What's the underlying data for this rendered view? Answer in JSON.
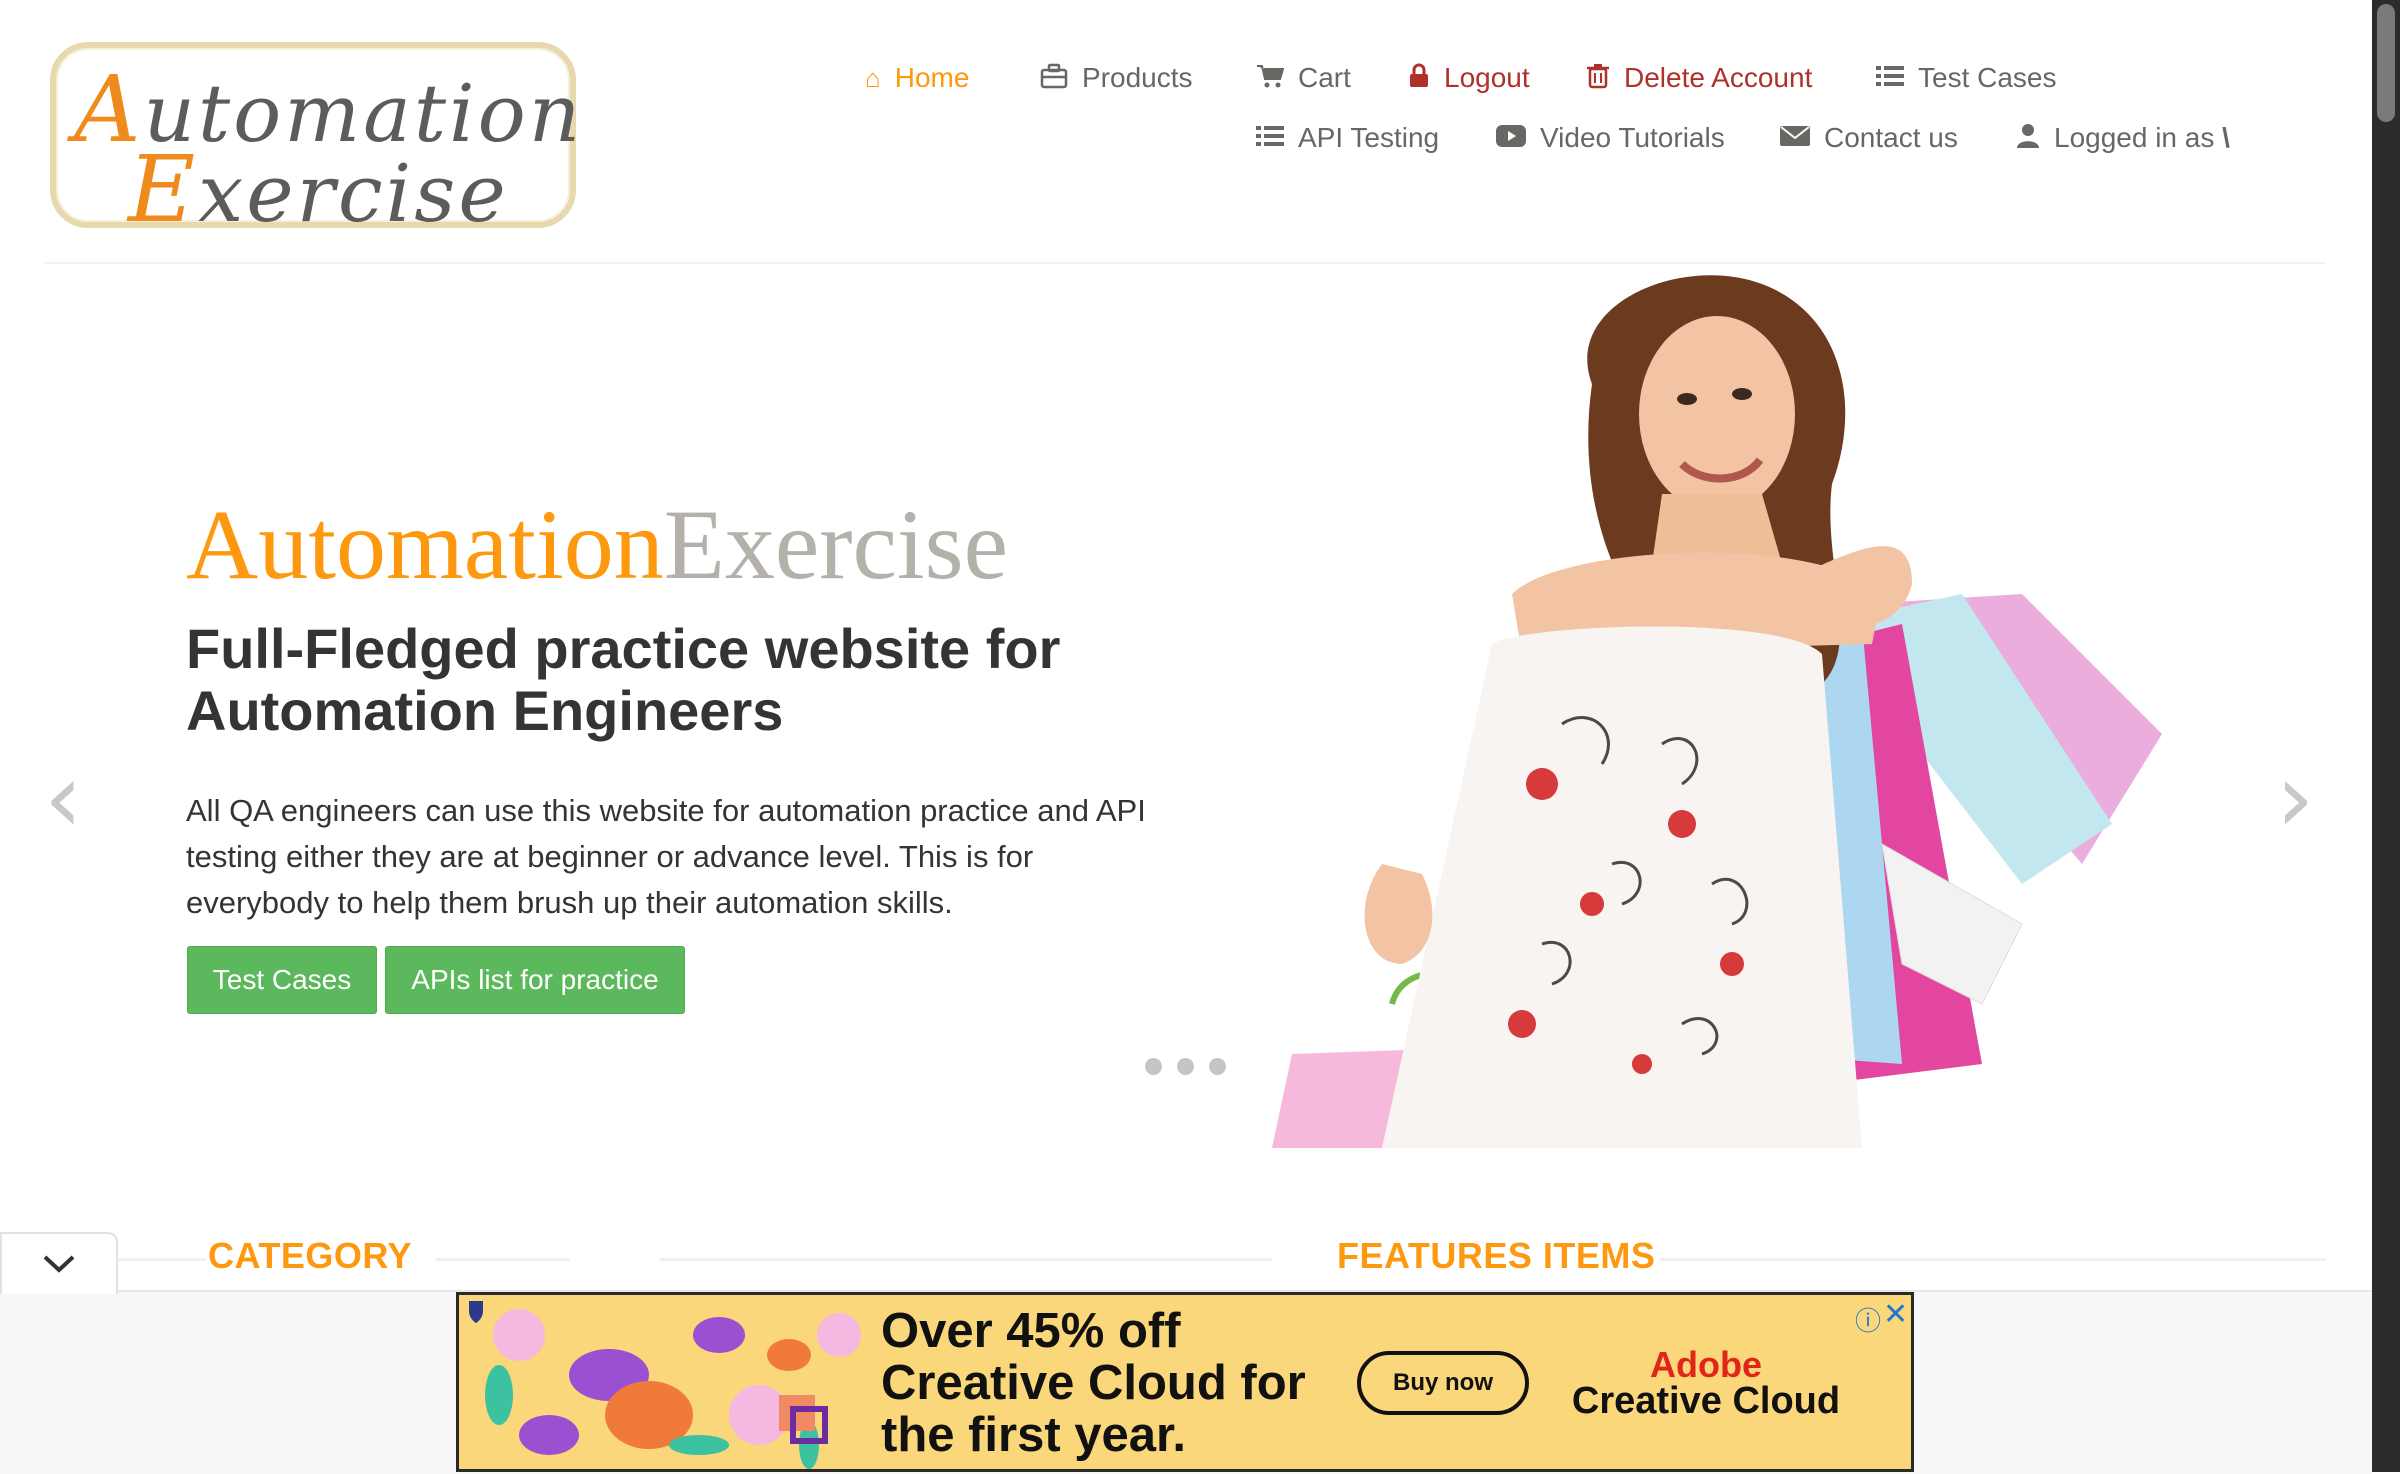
{
  "logo": {
    "line1_cap": "A",
    "line1_rest": "utomation",
    "line2_cap": "E",
    "line2_rest": "xercise"
  },
  "nav": {
    "home": "Home",
    "products": "Products",
    "cart": "Cart",
    "logout": "Logout",
    "delete_account": "Delete Account",
    "test_cases": "Test Cases",
    "api_testing": "API Testing",
    "video_tutorials": "Video Tutorials",
    "contact_us": "Contact us",
    "logged_in_as": "Logged in as",
    "logged_in_user": "\\"
  },
  "hero": {
    "brand_part1": "Automation",
    "brand_part2": "Exercise",
    "heading": "Full-Fledged practice website for Automation Engineers",
    "description": "All QA engineers can use this website for automation practice and API testing either they are at beginner or advance level. This is for everybody to help them brush up their automation skills.",
    "btn_test_cases": "Test Cases",
    "btn_apis": "APIs list for practice",
    "prev_arrow": "‹",
    "next_arrow": "›"
  },
  "sections": {
    "category": "CATEGORY",
    "features": "FEATURES ITEMS"
  },
  "ad": {
    "headline": "Over 45% off Creative Cloud for the first year.",
    "button": "Buy now",
    "brand_line1": "Adobe",
    "brand_line2": "Creative Cloud",
    "info_icon": "ⓘ",
    "close_icon": "✕"
  },
  "colors": {
    "accent": "#fe980f",
    "green": "#5cb85c",
    "text": "#696763",
    "danger": "#b0302a"
  }
}
